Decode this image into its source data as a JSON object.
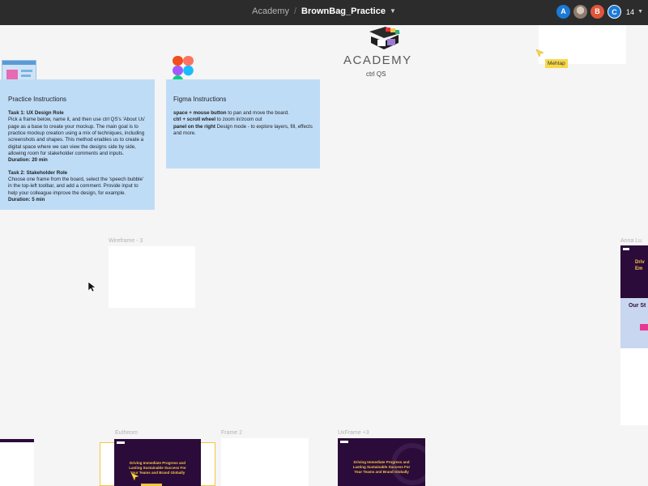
{
  "topbar": {
    "project": "Academy",
    "separator": "/",
    "file_name": "BrownBag_Practice",
    "avatars": [
      "A",
      "B",
      "C"
    ],
    "collaborator_count": "14"
  },
  "logo": {
    "academy": "ACADEMY",
    "brand_main": "ctrl",
    "brand_qs": "QS"
  },
  "cursor_tag": "Mehtap",
  "practice": {
    "title": "Practice Instructions",
    "task1_title": "Task 1: UX Design Role",
    "task1_body": "Pick a frame below, name it, and then use ctrl QS's 'About Us' page as a base to create your mockup. The main goal is to practice mockup creation using a mix of techniques, including screenshots and shapes. This method enables us to create a digital space where we can view the designs side by side, allowing room for stakeholder comments and inputs.",
    "task1_duration": "Duration: 20 min",
    "task2_title": "Task 2: Stakeholder Role",
    "task2_body": "Choose one frame from the board, select the 'speech bubble' in the top-left toolbar, and add a comment. Provide input to help your colleague improve the design, for example.",
    "task2_duration": "Duration: 5 min"
  },
  "figma": {
    "title": "Figma Instructions",
    "line1_bold": "space + mouse button",
    "line1_rest": " to pan and move the board.",
    "line2_bold": "ctrl + scroll wheel",
    "line2_rest": " to zoom in/zoom out",
    "line3_bold": "panel on the right",
    "line3_rest": " Design mode - to explore layers, fill, effects and more."
  },
  "frames": {
    "wireframe3": "Wireframe - 3",
    "right_top": "Anna Lu",
    "bottom1": "Eutheom",
    "frame2": "Frame 2",
    "ux_frame": "UxFrame +3"
  },
  "mockup": {
    "headline": "Driving Immediate Progress and Lasting Sustainable Success For Your Teams and Brand Globally",
    "right_headline": "Driv Em",
    "right_section": "Our St"
  },
  "colors": {
    "sticky_blue": "#bfdcf7",
    "mockup_purple": "#2b0b3a",
    "selection_yellow": "#f4c542",
    "accent_pink": "#e6388f"
  }
}
